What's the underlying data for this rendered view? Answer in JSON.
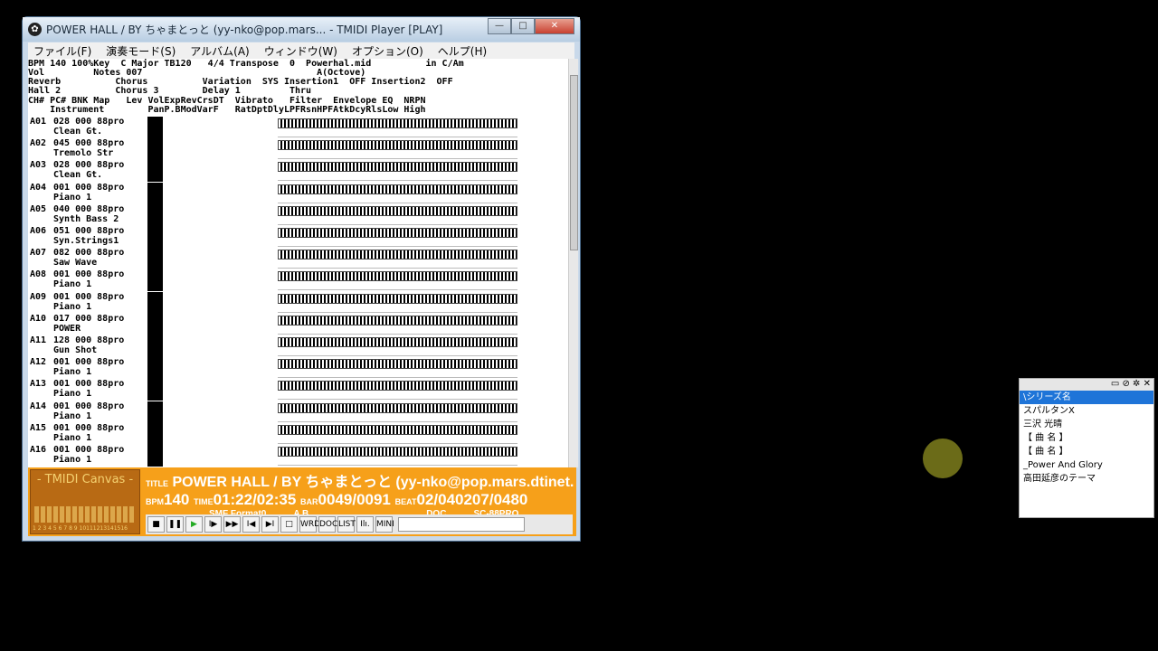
{
  "title": "POWER HALL / BY ちゃまとっと (yy-nko@pop.mars... - TMIDI Player [PLAY]",
  "menu": [
    "ファイル(F)",
    "演奏モード(S)",
    "アルバム(A)",
    "ウィンドウ(W)",
    "オプション(O)",
    "ヘルプ(H)"
  ],
  "hdr1": "BPM 140 100%Key  C Major TB120   4/4 Transpose  0  Powerhal.mid          in C/Am",
  "hdr2": "Vol         Notes 007                                A(Octove)",
  "hdr3": "Reverb          Chorus          Variation  SYS Insertion1  OFF Insertion2  OFF",
  "hdr4": "Hall 2          Chorus 3        Delay 1         Thru",
  "hdr5": "CH# PC# BNK Map   Lev VolExpRevCrsDT  Vibrato   Filter  Envelope EQ  NRPN",
  "hdr6": "    Instrument        PanP.BModVarF   RatDptDlyLPFRsnHPFAtkDcyRlsLow High",
  "channels": [
    {
      "ch": "A01",
      "prog": "028 000 88pro",
      "inst": "Clean Gt."
    },
    {
      "ch": "A02",
      "prog": "045 000 88pro",
      "inst": "Tremolo Str"
    },
    {
      "ch": "A03",
      "prog": "028 000 88pro",
      "inst": "Clean Gt."
    },
    {
      "ch": "A04",
      "prog": "001 000 88pro",
      "inst": "Piano 1"
    },
    {
      "ch": "A05",
      "prog": "040 000 88pro",
      "inst": "Synth Bass 2"
    },
    {
      "ch": "A06",
      "prog": "051 000 88pro",
      "inst": "Syn.Strings1"
    },
    {
      "ch": "A07",
      "prog": "082 000 88pro",
      "inst": "Saw Wave"
    },
    {
      "ch": "A08",
      "prog": "001 000 88pro",
      "inst": "Piano 1"
    },
    {
      "ch": "A09",
      "prog": "001 000 88pro",
      "inst": "Piano 1"
    },
    {
      "ch": "A10",
      "prog": "017 000 88pro",
      "inst": "POWER"
    },
    {
      "ch": "A11",
      "prog": "128 000 88pro",
      "inst": "Gun Shot"
    },
    {
      "ch": "A12",
      "prog": "001 000 88pro",
      "inst": "Piano 1"
    },
    {
      "ch": "A13",
      "prog": "001 000 88pro",
      "inst": "Piano 1"
    },
    {
      "ch": "A14",
      "prog": "001 000 88pro",
      "inst": "Piano 1"
    },
    {
      "ch": "A15",
      "prog": "001 000 88pro",
      "inst": "Piano 1"
    },
    {
      "ch": "A16",
      "prog": "001 000 88pro",
      "inst": "Piano 1"
    }
  ],
  "canvas_label": "- TMIDI Canvas -",
  "canvas_nums": "1 2 3 4 5 6 7 8 9 10111213141516",
  "disp": {
    "title_k": "TITLE",
    "title_v": "POWER HALL / BY ちゃまとっと (yy-nko@pop.mars.dtinet.or.j",
    "bpm_k": "BPM",
    "bpm_v": "140",
    "time_k": "TIME",
    "time_v": "01:22/02:35",
    "bar_k": "BAR",
    "bar_v": "0049/0091",
    "beat_k": "BEAT",
    "beat_v": "02/040207/0480",
    "fmt": "SMF Format0",
    "ab": "A B",
    "doc": "DOC",
    "sc": "SC-88PRO"
  },
  "ctrl_labels": [
    "■",
    "❚❚",
    "▶",
    "I▶",
    "▶▶",
    "I◀",
    "▶I",
    "□",
    "WRD",
    "DOC",
    "LIST",
    "Ilı.",
    "MINI"
  ],
  "palette": [
    "\\シリーズ名",
    "スパルタンX",
    "三沢 光晴",
    "【 曲 名 】",
    "【 曲 名 】",
    "_Power And Glory",
    "高田延彦のテーマ"
  ]
}
